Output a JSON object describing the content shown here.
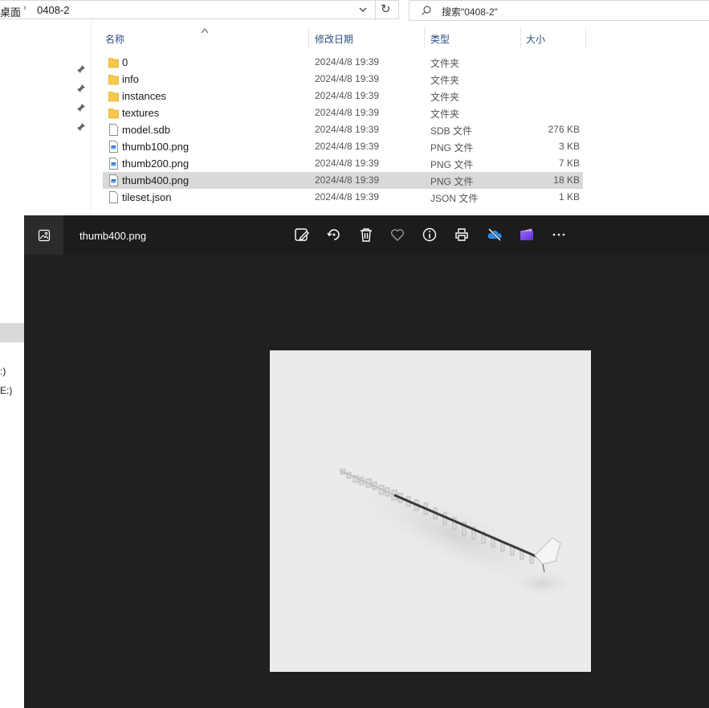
{
  "explorer": {
    "breadcrumb": [
      "桌面",
      "0408-2"
    ],
    "search_placeholder": "搜索\"0408-2\"",
    "columns": {
      "name": "名称",
      "modified": "修改日期",
      "type": "类型",
      "size": "大小"
    },
    "files": [
      {
        "name": "0",
        "modified": "2024/4/8 19:39",
        "type": "文件夹",
        "size": "",
        "icon": "folder-icon"
      },
      {
        "name": "info",
        "modified": "2024/4/8 19:39",
        "type": "文件夹",
        "size": "",
        "icon": "folder-icon"
      },
      {
        "name": "instances",
        "modified": "2024/4/8 19:39",
        "type": "文件夹",
        "size": "",
        "icon": "folder-icon"
      },
      {
        "name": "textures",
        "modified": "2024/4/8 19:39",
        "type": "文件夹",
        "size": "",
        "icon": "folder-icon"
      },
      {
        "name": "model.sdb",
        "modified": "2024/4/8 19:39",
        "type": "SDB 文件",
        "size": "276 KB",
        "icon": "file-icon"
      },
      {
        "name": "thumb100.png",
        "modified": "2024/4/8 19:39",
        "type": "PNG 文件",
        "size": "3 KB",
        "icon": "image-file-icon"
      },
      {
        "name": "thumb200.png",
        "modified": "2024/4/8 19:39",
        "type": "PNG 文件",
        "size": "7 KB",
        "icon": "image-file-icon"
      },
      {
        "name": "thumb400.png",
        "modified": "2024/4/8 19:39",
        "type": "PNG 文件",
        "size": "18 KB",
        "icon": "image-file-icon",
        "selected": true
      },
      {
        "name": "tileset.json",
        "modified": "2024/4/8 19:39",
        "type": "JSON 文件",
        "size": "1 KB",
        "icon": "file-icon"
      }
    ],
    "sidebar_fragments": [
      ":)",
      "E:)"
    ]
  },
  "viewer": {
    "title": "thumb400.png",
    "toolbar": [
      "edit-icon",
      "rotate-icon",
      "delete-icon",
      "favorite-icon",
      "info-icon",
      "print-icon",
      "onedrive-icon",
      "clipchamp-icon",
      "more-icon"
    ]
  },
  "colors": {
    "viewer_bg": "#202020",
    "folder": "#f6c94a",
    "header_text": "#2a4e7f",
    "selected_row": "#d9d9d9"
  }
}
